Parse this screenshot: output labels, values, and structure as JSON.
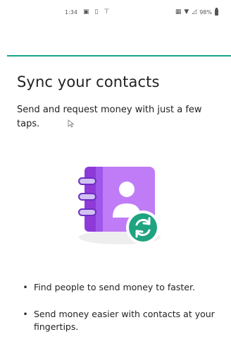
{
  "status_bar": {
    "time": "1:34",
    "battery": "98%",
    "icons": [
      "notification-icon",
      "sim-icon",
      "antenna-icon",
      "cast-icon",
      "wifi-icon",
      "signal-icon",
      "battery-icon"
    ]
  },
  "header": {
    "accent_color": "#17a589"
  },
  "main": {
    "title": "Sync your contacts",
    "subtitle": "Send and request money with just a few taps.",
    "illustration_icon": "contacts-sync-icon",
    "bullets": [
      "Find people to send money to faster.",
      "Send money easier with contacts at your fingertips."
    ]
  }
}
